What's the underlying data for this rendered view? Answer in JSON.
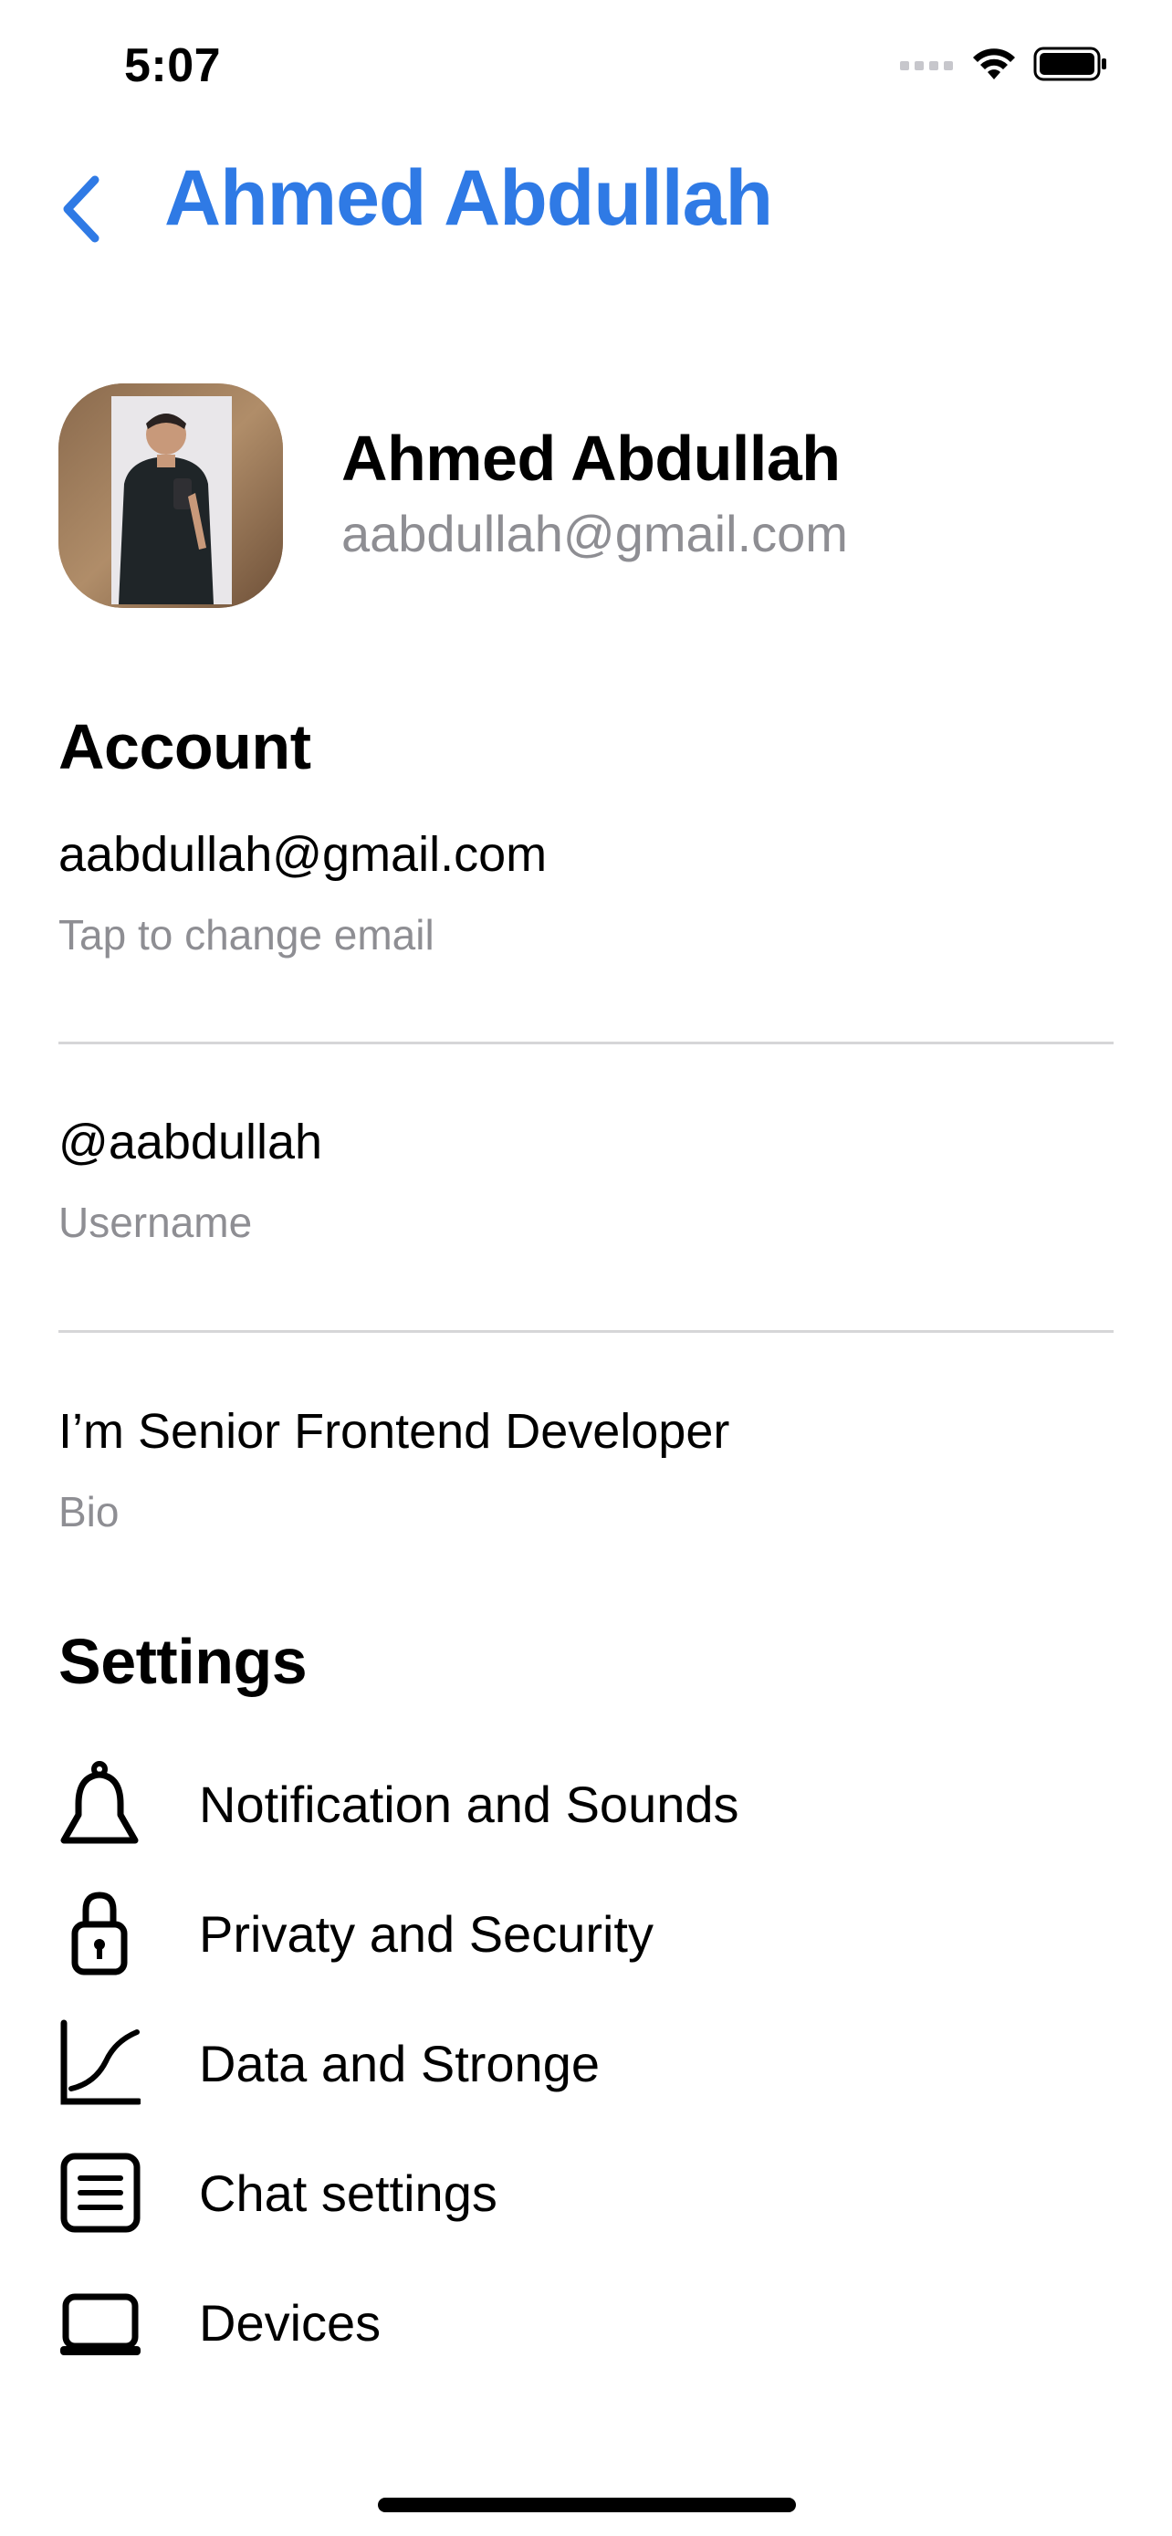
{
  "status_bar": {
    "time": "5:07"
  },
  "header": {
    "title": "Ahmed Abdullah",
    "back_icon": "chevron-left-icon",
    "accent_color": "#2f7ae5"
  },
  "profile": {
    "name": "Ahmed Abdullah",
    "email": "aabdullah@gmail.com"
  },
  "account": {
    "title": "Account",
    "rows": [
      {
        "value": "aabdullah@gmail.com",
        "label": "Tap to change email"
      },
      {
        "value": "@aabdullah",
        "label": "Username"
      },
      {
        "value": "I’m Senior Frontend Developer",
        "label": "Bio"
      }
    ]
  },
  "settings": {
    "title": "Settings",
    "items": [
      {
        "label": "Notification and Sounds",
        "icon": "bell-icon"
      },
      {
        "label": "Privaty and Security",
        "icon": "lock-icon"
      },
      {
        "label": "Data and Stronge",
        "icon": "chart-icon"
      },
      {
        "label": "Chat settings",
        "icon": "chat-list-icon"
      },
      {
        "label": "Devices",
        "icon": "laptop-icon"
      }
    ]
  }
}
